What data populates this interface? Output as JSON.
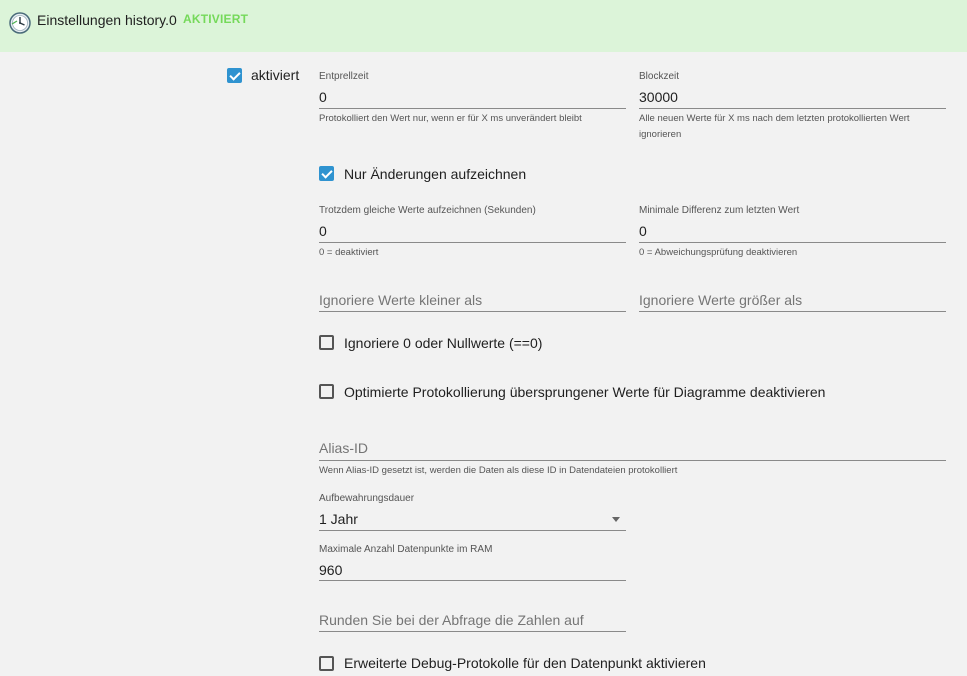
{
  "header": {
    "title": "Einstellungen history.0",
    "status": "AKTIVIERT"
  },
  "enabled": {
    "label": "aktiviert",
    "checked": true
  },
  "debounce": {
    "label": "Entprellzeit",
    "value": "0",
    "help": "Protokolliert den Wert nur, wenn er für X ms unverändert bleibt"
  },
  "blocktime": {
    "label": "Blockzeit",
    "value": "30000",
    "help": "Alle neuen Werte für X ms nach dem letzten protokollierten Wert ignorieren"
  },
  "changes_only": {
    "label": "Nur Änderungen aufzeichnen",
    "checked": true
  },
  "change_same": {
    "label": "Trotzdem gleiche Werte aufzeichnen (Sekunden)",
    "value": "0",
    "help": "0 = deaktiviert"
  },
  "min_diff": {
    "label": "Minimale Differenz zum letzten Wert",
    "value": "0",
    "help": "0 = Abweichungsprüfung deaktivieren"
  },
  "ignore_below": {
    "placeholder": "Ignoriere Werte kleiner als"
  },
  "ignore_above": {
    "placeholder": "Ignoriere Werte größer als"
  },
  "ignore_zero": {
    "label": "Ignoriere 0 oder Nullwerte (==0)",
    "checked": false
  },
  "disable_optimized": {
    "label": "Optimierte Protokollierung übersprungener Werte für Diagramme deaktivieren",
    "checked": false
  },
  "alias": {
    "placeholder": "Alias-ID",
    "help": "Wenn Alias-ID gesetzt ist, werden die Daten als diese ID in Datendateien protokolliert"
  },
  "retention": {
    "label": "Aufbewahrungsdauer",
    "value": "1 Jahr"
  },
  "max_points": {
    "label": "Maximale Anzahl Datenpunkte im RAM",
    "value": "960"
  },
  "round": {
    "placeholder": "Runden Sie bei der Abfrage die Zahlen auf"
  },
  "debug": {
    "label": "Erweiterte Debug-Protokolle für den Datenpunkt aktivieren",
    "checked": false
  }
}
